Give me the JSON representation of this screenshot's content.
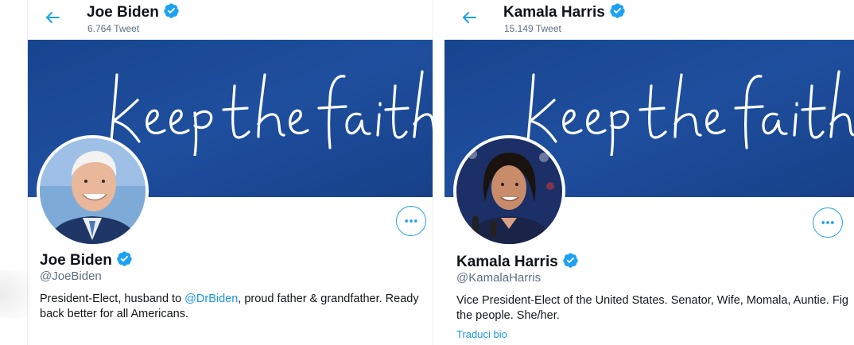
{
  "profiles": [
    {
      "header_name": "Joe Biden",
      "tweet_count": "6.764 Tweet",
      "banner_text": "keep the faith!",
      "name": "Joe Biden",
      "handle": "@JoeBiden",
      "bio_line1_pre": "President-Elect, husband to ",
      "bio_mention": "@DrBiden",
      "bio_line1_post": ", proud father & grandfather. Ready",
      "bio_line2": "back better for all Americans."
    },
    {
      "header_name": "Kamala Harris",
      "tweet_count": "15.149 Tweet",
      "banner_text": "keep the faith!",
      "name": "Kamala Harris",
      "handle": "@KamalaHarris",
      "bio_line1": "Vice President-Elect of the United States. Senator, Wife, Momala, Auntie. Fig",
      "bio_line2": "the people. She/her.",
      "translate_label": "Traduci bio"
    }
  ],
  "icons": {
    "back": "arrow-left-icon",
    "verified": "verified-badge-icon",
    "more": "more-options-icon"
  },
  "colors": {
    "accent": "#1da1f2",
    "banner": "#1d4ea0",
    "verified": "#1da1f2"
  }
}
